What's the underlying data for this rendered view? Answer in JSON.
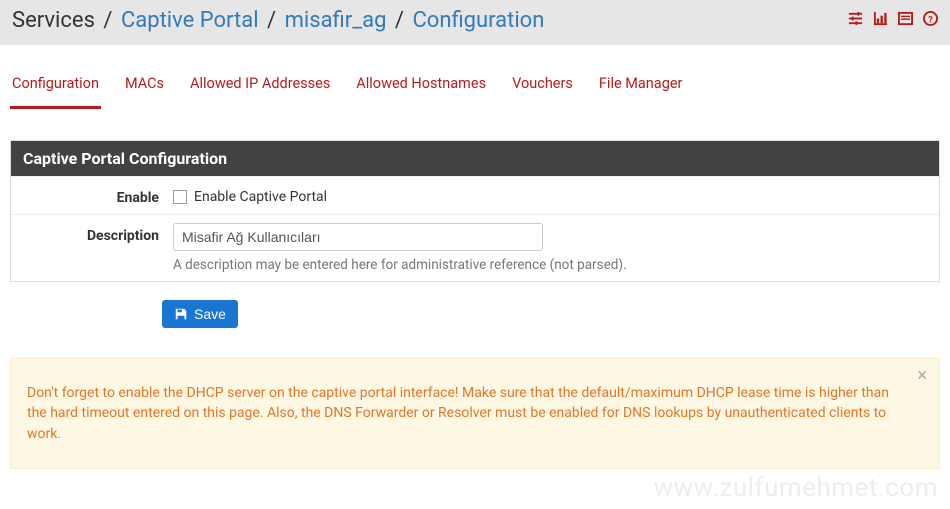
{
  "breadcrumb": {
    "root": "Services",
    "sep": "/",
    "items": [
      "Captive Portal",
      "misafir_ag",
      "Configuration"
    ]
  },
  "tabs": [
    {
      "label": "Configuration",
      "active": true
    },
    {
      "label": "MACs",
      "active": false
    },
    {
      "label": "Allowed IP Addresses",
      "active": false
    },
    {
      "label": "Allowed Hostnames",
      "active": false
    },
    {
      "label": "Vouchers",
      "active": false
    },
    {
      "label": "File Manager",
      "active": false
    }
  ],
  "panel": {
    "title": "Captive Portal Configuration",
    "enable": {
      "label": "Enable",
      "checkbox_label": "Enable Captive Portal",
      "checked": false
    },
    "description": {
      "label": "Description",
      "value": "Misafir Ağ Kullanıcıları",
      "help": "A description may be entered here for administrative reference (not parsed)."
    },
    "save_label": "Save"
  },
  "alert": {
    "text": "Don't forget to enable the DHCP server on the captive portal interface! Make sure that the default/maximum DHCP lease time is higher than the hard timeout entered on this page. Also, the DNS Forwarder or Resolver must be enabled for DNS lookups by unauthenticated clients to work."
  },
  "watermark": "www.zulfumehmet.com"
}
